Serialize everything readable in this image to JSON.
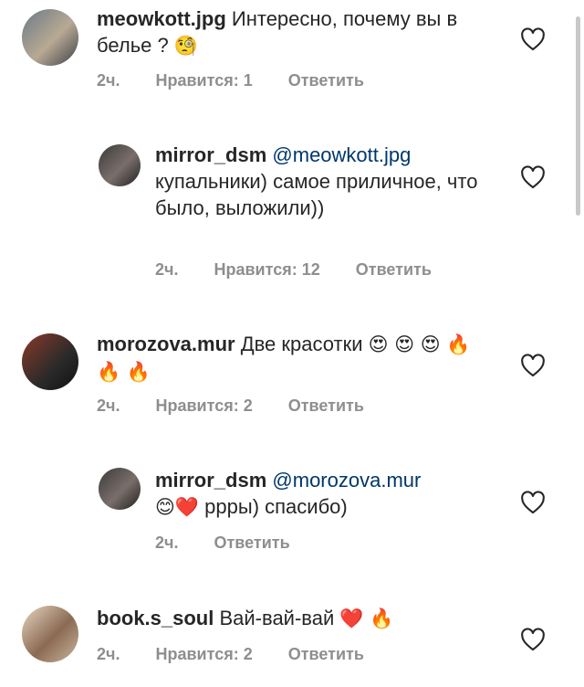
{
  "comments": [
    {
      "username": "meowkott.jpg",
      "mention": "",
      "text": "Интересно, почему вы в белье ?",
      "emoji": "🧐",
      "time": "2ч.",
      "likes": "Нравится: 1",
      "reply": "Ответить"
    },
    {
      "username": "mirror_dsm",
      "mention": "@meowkott.jpg",
      "text": "купальники) самое приличное, что было, выложили))",
      "emoji": "",
      "time": "2ч.",
      "likes": "Нравится: 12",
      "reply": "Ответить"
    },
    {
      "username": "morozova.mur",
      "mention": "",
      "text": "Две красотки",
      "emoji": "😍 😍 😍 🔥 🔥 🔥",
      "time": "2ч.",
      "likes": "Нравится: 2",
      "reply": "Ответить"
    },
    {
      "username": "mirror_dsm",
      "mention": "@morozova.mur",
      "text": "ррры) спасибо)",
      "emoji": "😊❤️",
      "time": "2ч.",
      "likes": "",
      "reply": "Ответить"
    },
    {
      "username": "book.s_soul",
      "mention": "",
      "text": "Вай-вай-вай",
      "emoji": "❤️ 🔥",
      "time": "2ч.",
      "likes": "Нравится: 2",
      "reply": "Ответить"
    }
  ],
  "icons": {
    "like": "heart-outline-icon"
  },
  "colors": {
    "username": "#262626",
    "mention": "#00376b",
    "meta": "#8e8e8e"
  }
}
